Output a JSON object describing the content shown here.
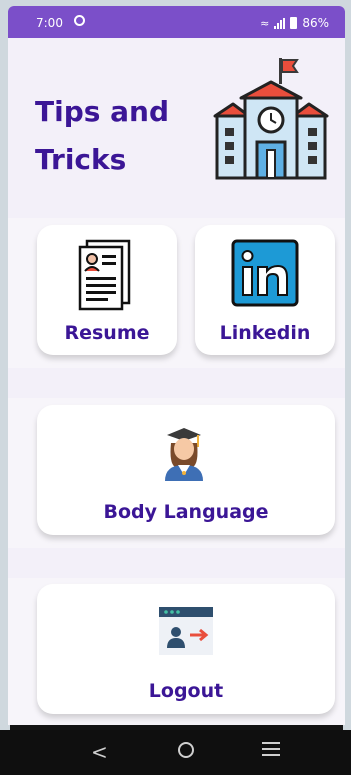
{
  "status_bar": {
    "time": "7:00",
    "battery": "86%",
    "background": "#7b4fc9"
  },
  "header": {
    "title_line1": "Tips and",
    "title_line2": "Tricks",
    "illustration": "school-building-icon"
  },
  "cards": {
    "resume": {
      "label": "Resume",
      "icon": "resume-document-icon"
    },
    "linkedin": {
      "label": "Linkedin",
      "icon": "linkedin-logo-icon"
    },
    "body_language": {
      "label": "Body Language",
      "icon": "graduate-woman-icon"
    },
    "logout": {
      "label": "Logout",
      "icon": "logout-window-icon"
    }
  },
  "colors": {
    "title": "#3b1696",
    "accent": "#7b4fc9",
    "card_background": "#ffffff",
    "page_background": "#f3f0f9"
  },
  "navigation": {
    "back": "<",
    "home": "home",
    "recents": "recents"
  }
}
